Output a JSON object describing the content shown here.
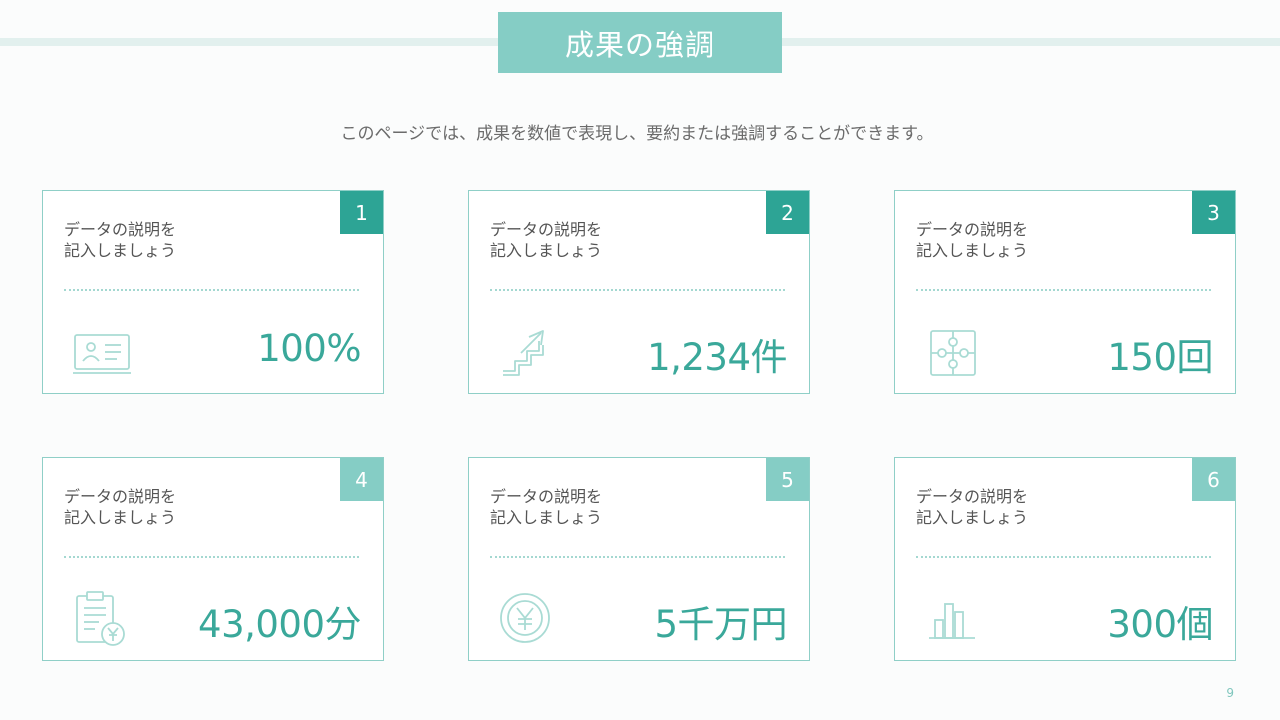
{
  "slide": {
    "title": "成果の強調",
    "subtitle": "このページでは、成果を数値で表現し、要約または強調することができます。",
    "page_number": "9"
  },
  "cards": [
    {
      "number": "1",
      "description": "データの説明を 記入しましょう",
      "value": "100%",
      "icon": "id-card-icon",
      "badge_color": "#2da495"
    },
    {
      "number": "2",
      "description": "データの説明を 記入しましょう",
      "value": "1,234件",
      "icon": "growth-stairs-icon",
      "badge_color": "#2da495"
    },
    {
      "number": "3",
      "description": "データの説明を 記入しましょう",
      "value": "150回",
      "icon": "puzzle-icon",
      "badge_color": "#2da495"
    },
    {
      "number": "4",
      "description": "データの説明を 記入しましょう",
      "value": "43,000分",
      "icon": "clipboard-yen-icon",
      "badge_color": "#85cdc5"
    },
    {
      "number": "5",
      "description": "データの説明を 記入しましょう",
      "value": "5千万円",
      "icon": "yen-coin-icon",
      "badge_color": "#85cdc5"
    },
    {
      "number": "6",
      "description": "データの説明を 記入しましょう",
      "value": "300個",
      "icon": "bar-chart-icon",
      "badge_color": "#85cdc5"
    }
  ]
}
